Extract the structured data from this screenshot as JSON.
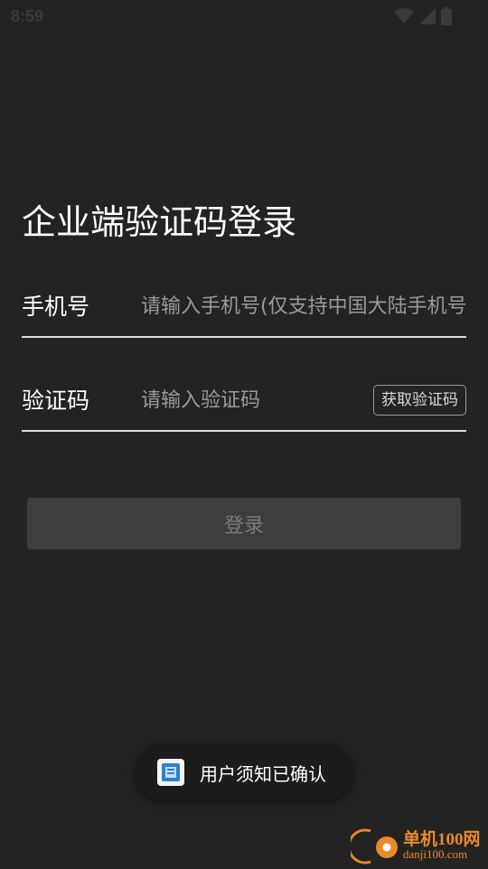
{
  "status_bar": {
    "time": "8:59",
    "icons": [
      "wifi-icon",
      "signal-icon",
      "battery-icon"
    ]
  },
  "page": {
    "title": "企业端验证码登录"
  },
  "form": {
    "phone": {
      "label": "手机号",
      "placeholder": "请输入手机号(仅支持中国大陆手机号)",
      "value": ""
    },
    "code": {
      "label": "验证码",
      "placeholder": "请输入验证码",
      "value": "",
      "get_code_label": "获取验证码"
    }
  },
  "login_button": {
    "label": "登录"
  },
  "toast": {
    "text": "用户须知已确认",
    "icon": "app-icon"
  },
  "watermark": {
    "title": "单机100网",
    "url": "danji100.com"
  },
  "colors": {
    "background": "#232323",
    "divider": "#dcdcdc",
    "placeholder": "#9a9a9a",
    "login_disabled_bg": "#3e3e3e",
    "login_disabled_text": "#7b7b7b",
    "watermark": "#e88a2a"
  }
}
